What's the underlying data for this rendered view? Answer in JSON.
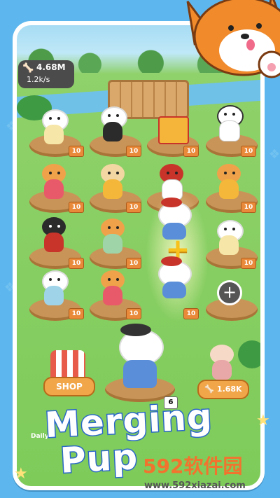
{
  "hud": {
    "coins": "4.68M",
    "rate": "1.2k/s",
    "coin_icon": "bone-icon"
  },
  "grid": {
    "rows": [
      [
        "white-pup",
        "cap-pup",
        "gift-box",
        "spotted-pup"
      ],
      [
        "shiba-sailor",
        "pug",
        "red-hood-pup",
        "shiba-flowers"
      ],
      [
        "black-pup",
        "shiba-plaid",
        "samoyed-pup-merge",
        "white-fluffy"
      ],
      [
        "hat-pup",
        "shiba-scarf",
        "samoyed-pup-merge",
        "empty"
      ]
    ],
    "level_badge": "10",
    "lv_badges": [
      "10",
      "10",
      "10",
      "10",
      "10",
      "10",
      "10",
      "10",
      "10",
      "10",
      "10",
      "10",
      "10"
    ]
  },
  "merge": {
    "plus_symbol": "+",
    "empty_slot_symbol": "+"
  },
  "shop": {
    "label": "SHOP"
  },
  "buy": {
    "price": "1.68K"
  },
  "counter": "6",
  "daily": "Daily",
  "title": {
    "line1": "Merging",
    "line2": "Pup"
  },
  "watermark": {
    "cn": "592软件园",
    "url": "www.592xiazai.com"
  }
}
